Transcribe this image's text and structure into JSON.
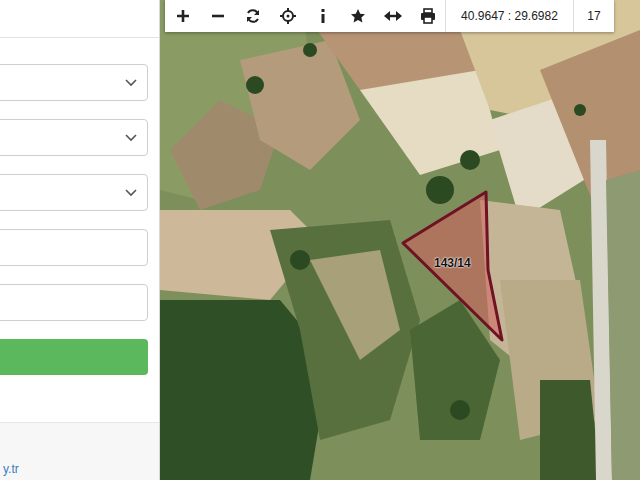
{
  "form": {
    "selects": [
      {
        "value": ""
      },
      {
        "value": ""
      },
      {
        "value": ""
      }
    ],
    "inputs": [
      {
        "value": ""
      },
      {
        "value": ""
      }
    ],
    "submit_button": {
      "label": ""
    },
    "footer_link": "y.tr"
  },
  "toolbar": {
    "coordinates": "40.9647 : 29.6982",
    "zoom": "17"
  },
  "map": {
    "parcels": [
      {
        "label": "143/14",
        "selected": true
      }
    ]
  }
}
